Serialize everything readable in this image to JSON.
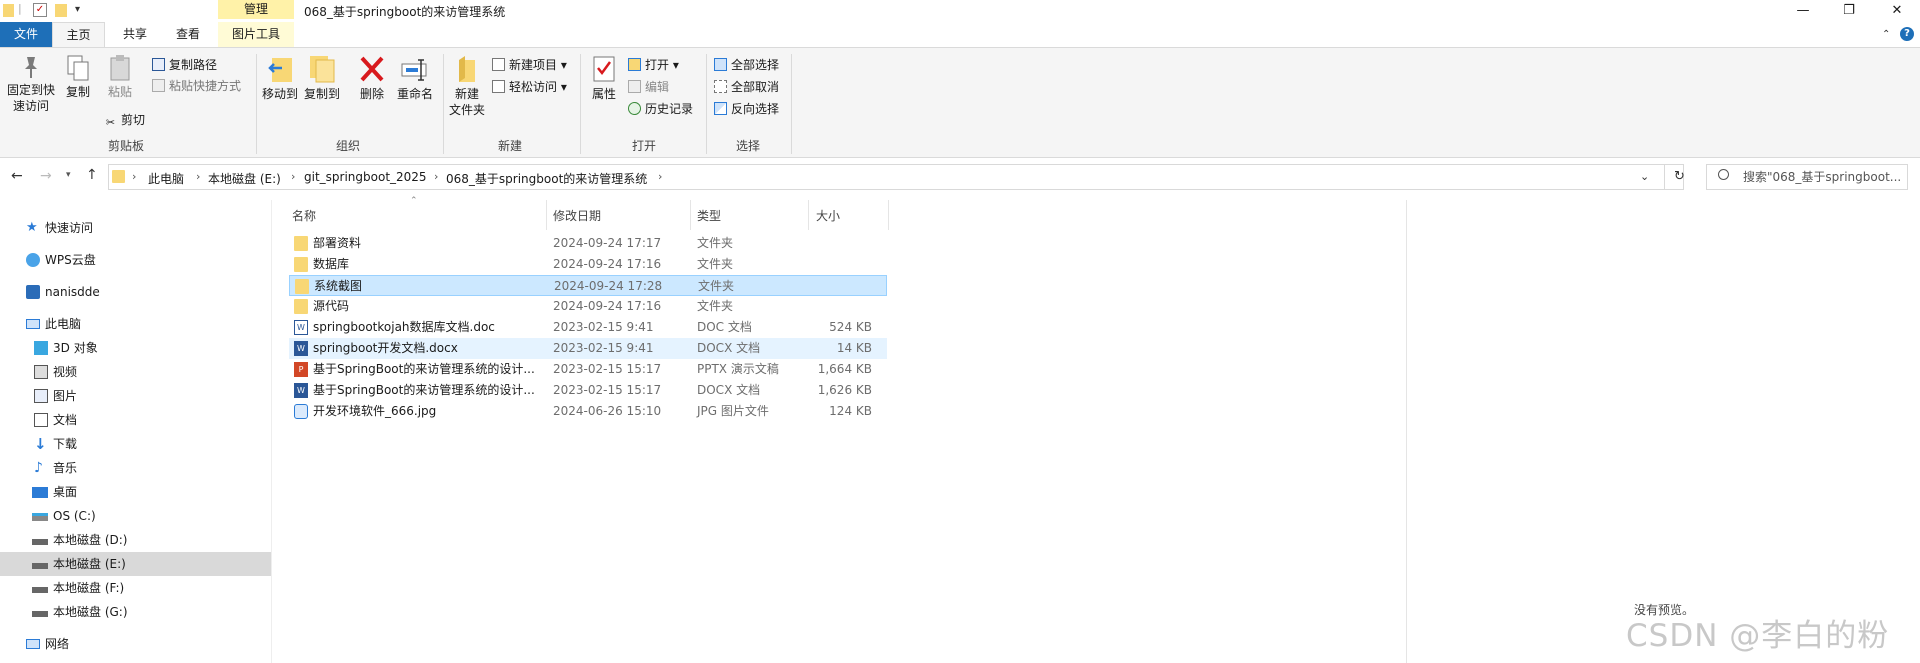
{
  "window": {
    "title": "068_基于springboot的来访管理系统",
    "context_tab": "管理",
    "controls": {
      "minimize": "—",
      "maximize": "❐",
      "close": "✕"
    }
  },
  "tabs": {
    "file": "文件",
    "home": "主页",
    "share": "共享",
    "view": "查看",
    "picture_tools": "图片工具"
  },
  "ribbon": {
    "clipboard": {
      "label": "剪贴板",
      "pin_line1": "固定到快",
      "pin_line2": "速访问",
      "copy": "复制",
      "paste": "粘贴",
      "copy_path": "复制路径",
      "paste_shortcut": "粘贴快捷方式",
      "cut": "剪切"
    },
    "organize": {
      "label": "组织",
      "move_to": "移动到",
      "copy_to": "复制到",
      "delete": "删除",
      "rename": "重命名"
    },
    "new": {
      "label": "新建",
      "new_folder_line1": "新建",
      "new_folder_line2": "文件夹",
      "new_item": "新建项目 ▾",
      "easy_access": "轻松访问 ▾"
    },
    "open": {
      "label": "打开",
      "properties": "属性",
      "open": "打开 ▾",
      "edit": "编辑",
      "history": "历史记录"
    },
    "select": {
      "label": "选择",
      "select_all": "全部选择",
      "select_none": "全部取消",
      "invert": "反向选择"
    }
  },
  "address": {
    "crumbs": [
      "此电脑",
      "本地磁盘 (E:)",
      "git_springboot_2025",
      "068_基于springboot的来访管理系统"
    ],
    "search_placeholder": "搜索\"068_基于springboot..."
  },
  "nav": {
    "quick_access": "快速访问",
    "wps": "WPS云盘",
    "user": "nanisdde",
    "this_pc": "此电脑",
    "objects3d": "3D 对象",
    "videos": "视频",
    "pictures": "图片",
    "documents": "文档",
    "downloads": "下载",
    "music": "音乐",
    "desktop": "桌面",
    "os_c": "OS (C:)",
    "disk_d": "本地磁盘 (D:)",
    "disk_e": "本地磁盘 (E:)",
    "disk_f": "本地磁盘 (F:)",
    "disk_g": "本地磁盘 (G:)",
    "network": "网络"
  },
  "columns": {
    "name": "名称",
    "date": "修改日期",
    "type": "类型",
    "size": "大小"
  },
  "files": [
    {
      "name": "部署资料",
      "date": "2024-09-24 17:17",
      "type": "文件夹",
      "size": "",
      "icon": "folder-icon"
    },
    {
      "name": "数据库",
      "date": "2024-09-24 17:16",
      "type": "文件夹",
      "size": "",
      "icon": "folder-icon"
    },
    {
      "name": "系统截图",
      "date": "2024-09-24 17:28",
      "type": "文件夹",
      "size": "",
      "icon": "folder-icon"
    },
    {
      "name": "源代码",
      "date": "2024-09-24 17:16",
      "type": "文件夹",
      "size": "",
      "icon": "folder-icon"
    },
    {
      "name": "springbootkojah数据库文档.doc",
      "date": "2023-02-15 9:41",
      "type": "DOC 文档",
      "size": "524 KB",
      "icon": "word-doc-icon"
    },
    {
      "name": "springboot开发文档.docx",
      "date": "2023-02-15 9:41",
      "type": "DOCX 文档",
      "size": "14 KB",
      "icon": "word-docx-icon"
    },
    {
      "name": "基于SpringBoot的来访管理系统的设计...",
      "date": "2023-02-15 15:17",
      "type": "PPTX 演示文稿",
      "size": "1,664 KB",
      "icon": "pptx-icon"
    },
    {
      "name": "基于SpringBoot的来访管理系统的设计...",
      "date": "2023-02-15 15:17",
      "type": "DOCX 文档",
      "size": "1,626 KB",
      "icon": "word-docx-icon"
    },
    {
      "name": "开发环境软件_666.jpg",
      "date": "2024-06-26 15:10",
      "type": "JPG 图片文件",
      "size": "124 KB",
      "icon": "jpg-icon"
    }
  ],
  "preview": {
    "empty_text": "没有预览。"
  },
  "watermark": "CSDN @李白的粉",
  "colors": {
    "accent": "#1e6fb8",
    "selection": "#cce8ff",
    "folder": "#f8d775",
    "manage_tab": "#fff2a8"
  }
}
